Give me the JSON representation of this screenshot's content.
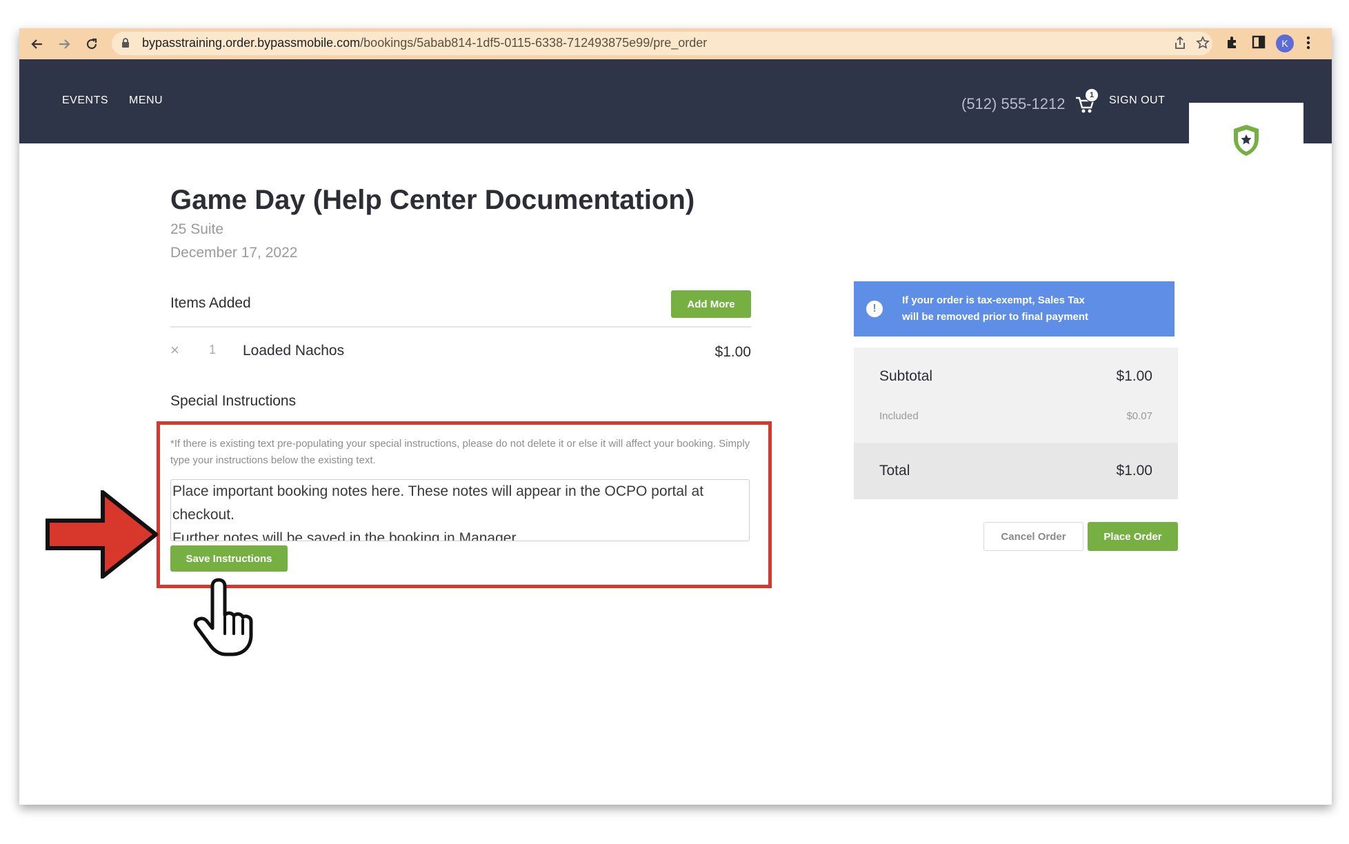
{
  "browser": {
    "url_domain": "bypasstraining.order.bypassmobile.com",
    "url_path": "/bookings/5abab814-1df5-0115-6338-712493875e99/pre_order",
    "profile_initial": "K"
  },
  "header": {
    "nav": [
      "EVENTS",
      "MENU"
    ],
    "phone": "(512) 555-1212",
    "cart_count": "1",
    "sign_out": "SIGN OUT"
  },
  "event": {
    "title": "Game Day (Help Center Documentation)",
    "suite": "25 Suite",
    "date": "December 17, 2022"
  },
  "items": {
    "heading": "Items Added",
    "add_more": "Add More",
    "list": [
      {
        "remove": "×",
        "qty": "1",
        "name": "Loaded Nachos",
        "price": "$1.00"
      }
    ]
  },
  "instructions": {
    "heading": "Special Instructions",
    "note": "*If there is existing text pre-populating your special instructions, please do not delete it or else it will affect your booking. Simply type your instructions below the existing text.",
    "text": "Place important booking notes here. These notes will appear in the OCPO portal at checkout.\nFurther notes will be saved in the booking in Manager.",
    "save_label": "Save Instructions"
  },
  "tax_notice": {
    "line1": "If your order is tax-exempt, Sales Tax",
    "line2": "will be removed prior to final payment"
  },
  "summary": {
    "subtotal_label": "Subtotal",
    "subtotal_value": "$1.00",
    "included_label": "Included",
    "included_value": "$0.07",
    "total_label": "Total",
    "total_value": "$1.00"
  },
  "actions": {
    "cancel": "Cancel Order",
    "place": "Place Order"
  },
  "colors": {
    "header_bg": "#2e3548",
    "green": "#76b043",
    "notice_blue": "#5f8ee6",
    "annotation_red": "#d8382c"
  }
}
